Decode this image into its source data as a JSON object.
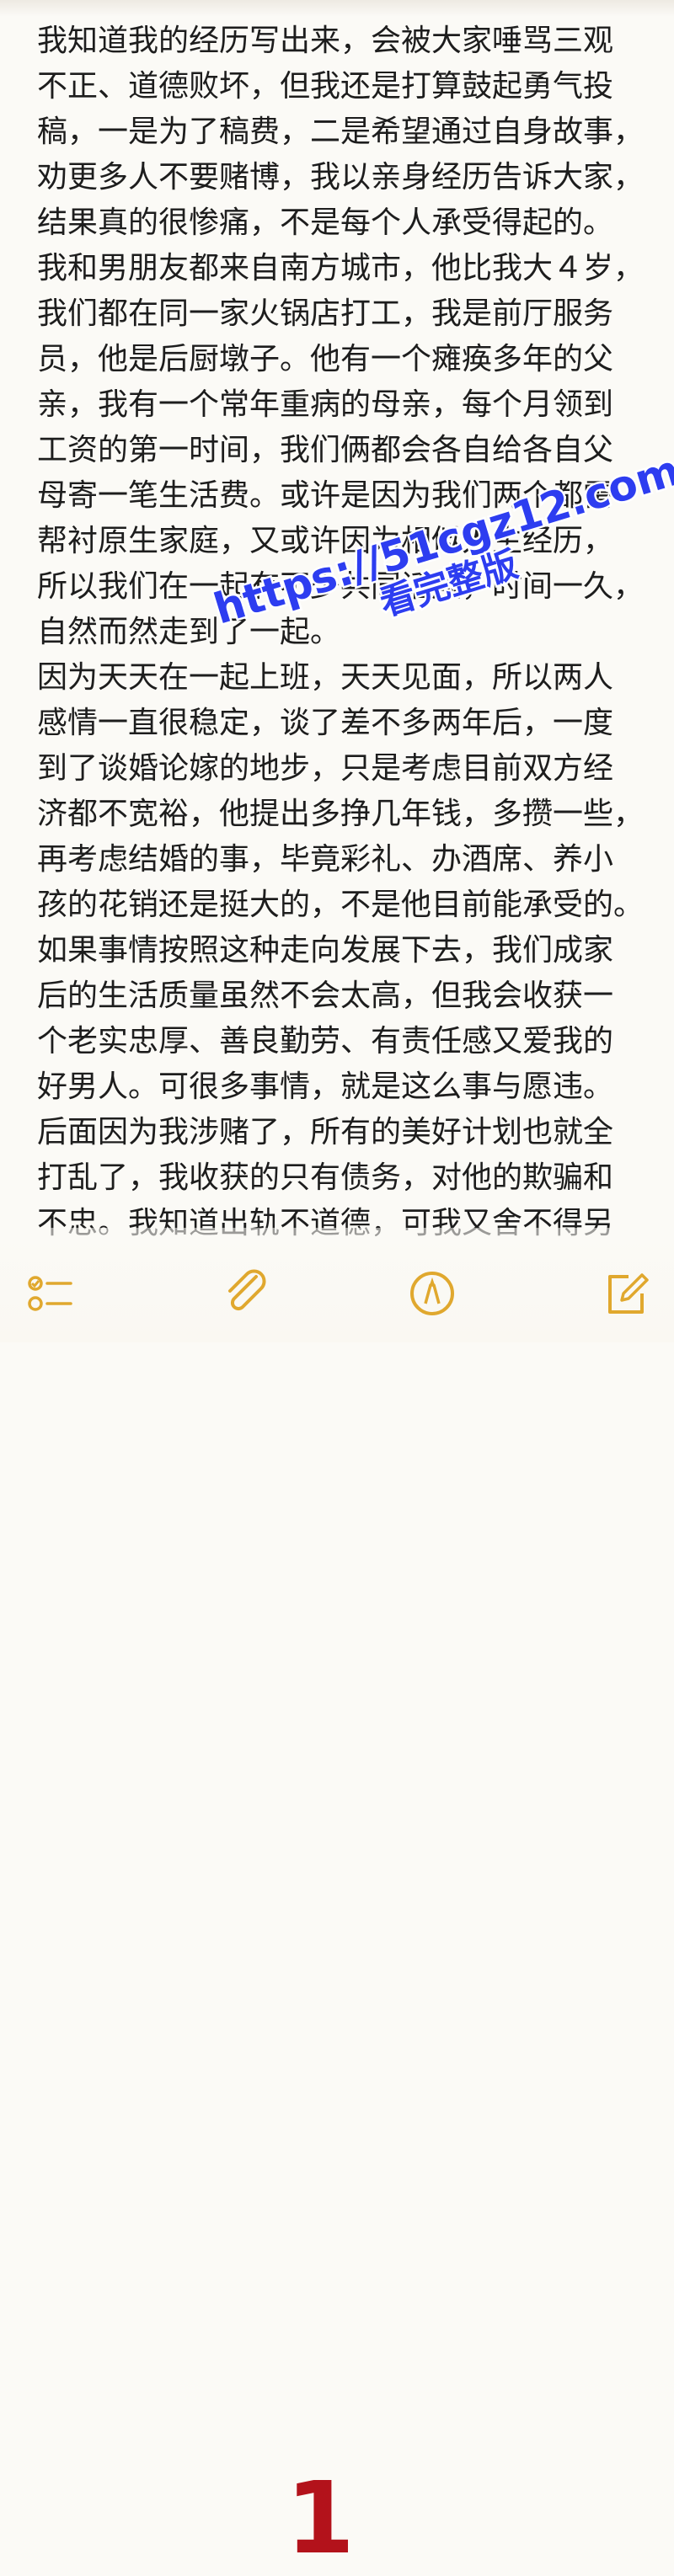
{
  "note": {
    "lines": [
      "我知道我的经历写出来，会被大家唾骂三观",
      "不正、道德败坏，但我还是打算鼓起勇气投",
      "稿，一是为了稿费，二是希望通过自身故事，",
      "劝更多人不要赌博，我以亲身经历告诉大家，",
      "结果真的很惨痛，不是每个人承受得起的。",
      "我和男朋友都来自南方城市，他比我大４岁，",
      "我们都在同一家火锅店打工，我是前厅服务",
      "员，他是后厨墩子。他有一个瘫痪多年的父",
      "亲，我有一个常年重病的母亲，每个月领到",
      "工资的第一时间，我们俩都会各自给各自父",
      "母寄一笔生活费。或许是因为我们两个都需",
      "帮衬原生家庭，又或许因为相似人生经历，",
      "所以我们在一起有不少共同话题，时间一久，",
      "自然而然走到了一起。",
      "因为天天在一起上班，天天见面，所以两人",
      "感情一直很稳定，谈了差不多两年后，一度",
      "到了谈婚论嫁的地步，只是考虑目前双方经",
      "济都不宽裕，他提出多挣几年钱，多攒一些，",
      "再考虑结婚的事，毕竟彩礼、办酒席、养小",
      "孩的花销还是挺大的，不是他目前能承受的。",
      "如果事情按照这种走向发展下去，我们成家",
      "后的生活质量虽然不会太高，但我会收获一",
      "个老实忠厚、善良勤劳、有责任感又爱我的",
      "好男人。可很多事情，就是这么事与愿违。",
      "后面因为我涉赌了，所有的美好计划也就全",
      "打乱了，我收获的只有债务，对他的欺骗和",
      "不忠。我知道出轨不道德，可我又舍不得另"
    ]
  },
  "watermark": {
    "url": "https://51cgz12.com",
    "subtitle": "看完整版"
  },
  "toolbar": {
    "checklist_icon": "checklist-icon",
    "attach_icon": "paperclip-icon",
    "markup_icon": "pen-circle-icon",
    "compose_icon": "compose-icon",
    "page_marker": "1"
  },
  "colors": {
    "background": "#fbfaf6",
    "text": "#1d1d1d",
    "accent_icon": "#e0a82e",
    "watermark": "#2d3df0",
    "page_marker": "#b3121b"
  }
}
